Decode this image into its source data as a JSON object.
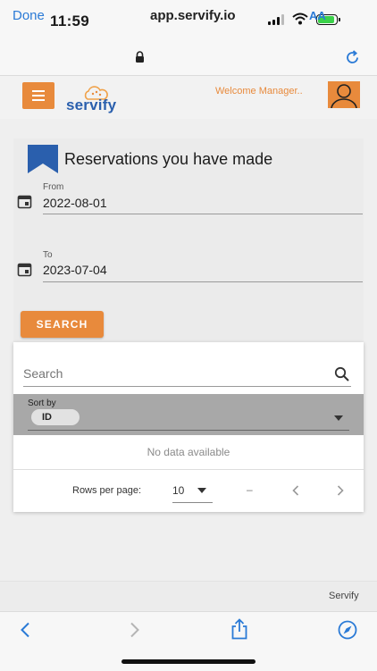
{
  "status_bar": {
    "time": "11:59"
  },
  "browser": {
    "done_label": "Done",
    "url": "app.servify.io",
    "text_size_label": "AA"
  },
  "header": {
    "logo_text": "servify",
    "welcome": "Welcome Manager.."
  },
  "reservations": {
    "title": "Reservations you have made",
    "from_label": "From",
    "from_value": "2022-08-01",
    "to_label": "To",
    "to_value": "2023-07-04",
    "search_button": "SEARCH"
  },
  "table": {
    "search_placeholder": "Search",
    "sort_label": "Sort by",
    "sort_value": "ID",
    "empty_text": "No data available",
    "rows_per_page_label": "Rows per page:",
    "rows_per_page_value": "10",
    "range_text": "–"
  },
  "footer": {
    "brand": "Servify"
  },
  "colors": {
    "accent": "#e88a3c",
    "link": "#2a7ad6",
    "brand_blue": "#2a5fad"
  }
}
